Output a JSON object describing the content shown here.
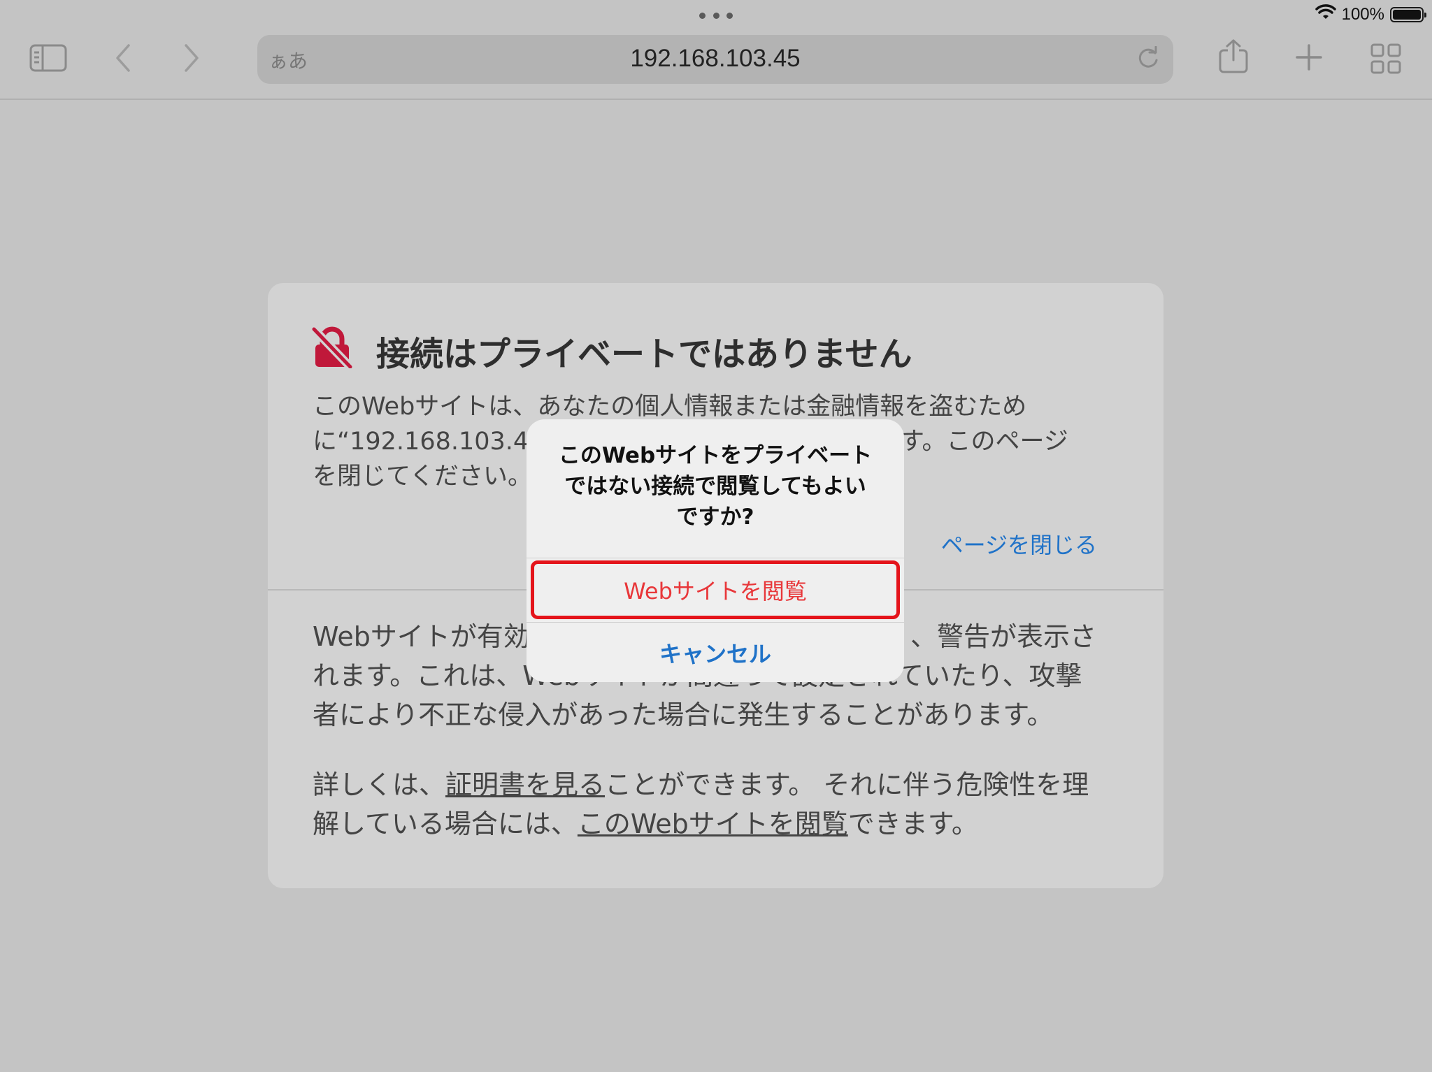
{
  "status": {
    "wifi_icon": "wifi-icon",
    "battery_percent": "100%"
  },
  "toolbar": {
    "sidebar_icon": "sidebar-icon",
    "back_icon": "chevron-left-icon",
    "forward_icon": "chevron-right-icon",
    "reader_label": "ぁあ",
    "url": "192.168.103.45",
    "reload_icon": "reload-icon",
    "share_icon": "share-icon",
    "new_tab_icon": "plus-icon",
    "tabs_icon": "tab-overview-icon"
  },
  "error_page": {
    "icon": "broken-lock-icon",
    "title": "接続はプライベートではありません",
    "body1_line1": "このWebサイトは、あなたの個人情報または金融情報を盗むため",
    "body1_line2a": "に“192.168.103.45",
    "body1_line2b": "ます。このページ",
    "body1_line3": "を閉じてください。",
    "close_page_link": "ページを閉じる",
    "body2_line1a": "Webサイトが有効",
    "body2_line1b": "、警告が表示さ",
    "body2_line2": "れます。これは、Webサイトが間違って設定されていたり、攻撃",
    "body2_line3": "者により不正な侵入があった場合に発生することがあります。",
    "body3_prefix": "詳しくは、",
    "body3_link1": "証明書を見る",
    "body3_mid": "ことができます。 それに伴う危険性を理",
    "body3_line2_prefix": "解している場合には、",
    "body3_link2": "このWebサイトを閲覧",
    "body3_suffix": "できます。"
  },
  "alert": {
    "title_line1": "このWebサイトをプライベート",
    "title_line2": "ではない接続で閲覧してもよい",
    "title_line3": "ですか?",
    "visit_button": "Webサイトを閲覧",
    "cancel_button": "キャンセル",
    "highlight_color": "#e4141b"
  }
}
